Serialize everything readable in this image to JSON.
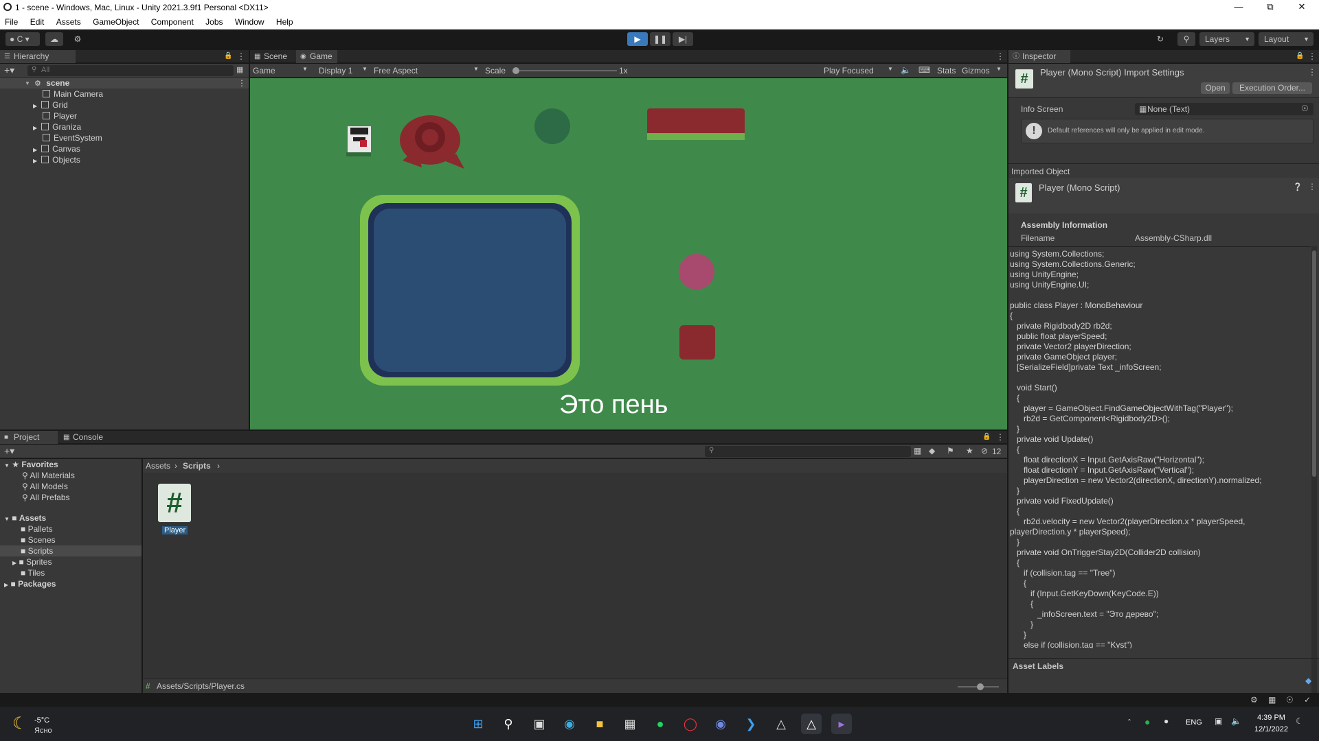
{
  "window": {
    "title": "1 - scene - Windows, Mac, Linux - Unity 2021.3.9f1 Personal <DX11>"
  },
  "menu": [
    "File",
    "Edit",
    "Assets",
    "GameObject",
    "Component",
    "Jobs",
    "Window",
    "Help"
  ],
  "toolbar": {
    "account": "C",
    "layers": "Layers",
    "layout": "Layout"
  },
  "hierarchy": {
    "title": "Hierarchy",
    "search_placeholder": "All",
    "scene": "scene",
    "items": [
      "Main Camera",
      "Grid",
      "Player",
      "Graniza",
      "EventSystem",
      "Canvas",
      "Objects"
    ]
  },
  "scene_tabs": {
    "scene": "Scene",
    "game": "Game"
  },
  "game_bar": {
    "game": "Game",
    "display": "Display 1",
    "aspect": "Free Aspect",
    "scale": "Scale",
    "scale_value": "1x",
    "play_focused": "Play Focused",
    "stats": "Stats",
    "gizmos": "Gizmos"
  },
  "game_view": {
    "caption": "Это пень",
    "bg": "#3f8a4a"
  },
  "inspector": {
    "title": "Inspector",
    "header": "Player (Mono Script) Import Settings",
    "open": "Open",
    "exec_order": "Execution Order...",
    "info_screen_label": "Info Screen",
    "info_screen_value": "None (Text)",
    "warning": "Default references will only be applied in edit mode.",
    "imported_object": "Imported Object",
    "script_name": "Player (Mono Script)",
    "assembly_info": "Assembly Information",
    "filename_label": "Filename",
    "filename_value": "Assembly-CSharp.dll",
    "asset_labels": "Asset Labels",
    "code": "using System.Collections;\nusing System.Collections.Generic;\nusing UnityEngine;\nusing UnityEngine.UI;\n\npublic class Player : MonoBehaviour\n{\n   private Rigidbody2D rb2d;\n   public float playerSpeed;\n   private Vector2 playerDirection;\n   private GameObject player;\n   [SerializeField]private Text _infoScreen;\n\n   void Start()\n   {\n      player = GameObject.FindGameObjectWithTag(\"Player\");\n      rb2d = GetComponent<Rigidbody2D>();\n   }\n   private void Update()\n   {\n      float directionX = Input.GetAxisRaw(\"Horizontal\");\n      float directionY = Input.GetAxisRaw(\"Vertical\");\n      playerDirection = new Vector2(directionX, directionY).normalized;\n   }\n   private void FixedUpdate()\n   {\n      rb2d.velocity = new Vector2(playerDirection.x * playerSpeed,\nplayerDirection.y * playerSpeed);\n   }\n   private void OnTriggerStay2D(Collider2D collision)\n   {\n      if (collision.tag == \"Tree\")\n      {\n         if (Input.GetKeyDown(KeyCode.E))\n         {\n            _infoScreen.text = \"Это дерево\";\n         }\n      }\n      else if (collision.tag == \"Kyst\")\n      {"
  },
  "project": {
    "tab_project": "Project",
    "tab_console": "Console",
    "hidden_count": "12",
    "favorites": "Favorites",
    "fav_items": [
      "All Materials",
      "All Models",
      "All Prefabs"
    ],
    "assets": "Assets",
    "asset_folders": [
      "Pallets",
      "Scenes",
      "Scripts",
      "Sprites",
      "Tiles"
    ],
    "packages": "Packages",
    "breadcrumb_root": "Assets",
    "breadcrumb_current": "Scripts",
    "file_name": "Player",
    "status_path": "Assets/Scripts/Player.cs"
  },
  "taskbar": {
    "temp": "-5°C",
    "weather": "Ясно",
    "lang": "ENG",
    "time": "4:39 PM",
    "date": "12/1/2022"
  }
}
